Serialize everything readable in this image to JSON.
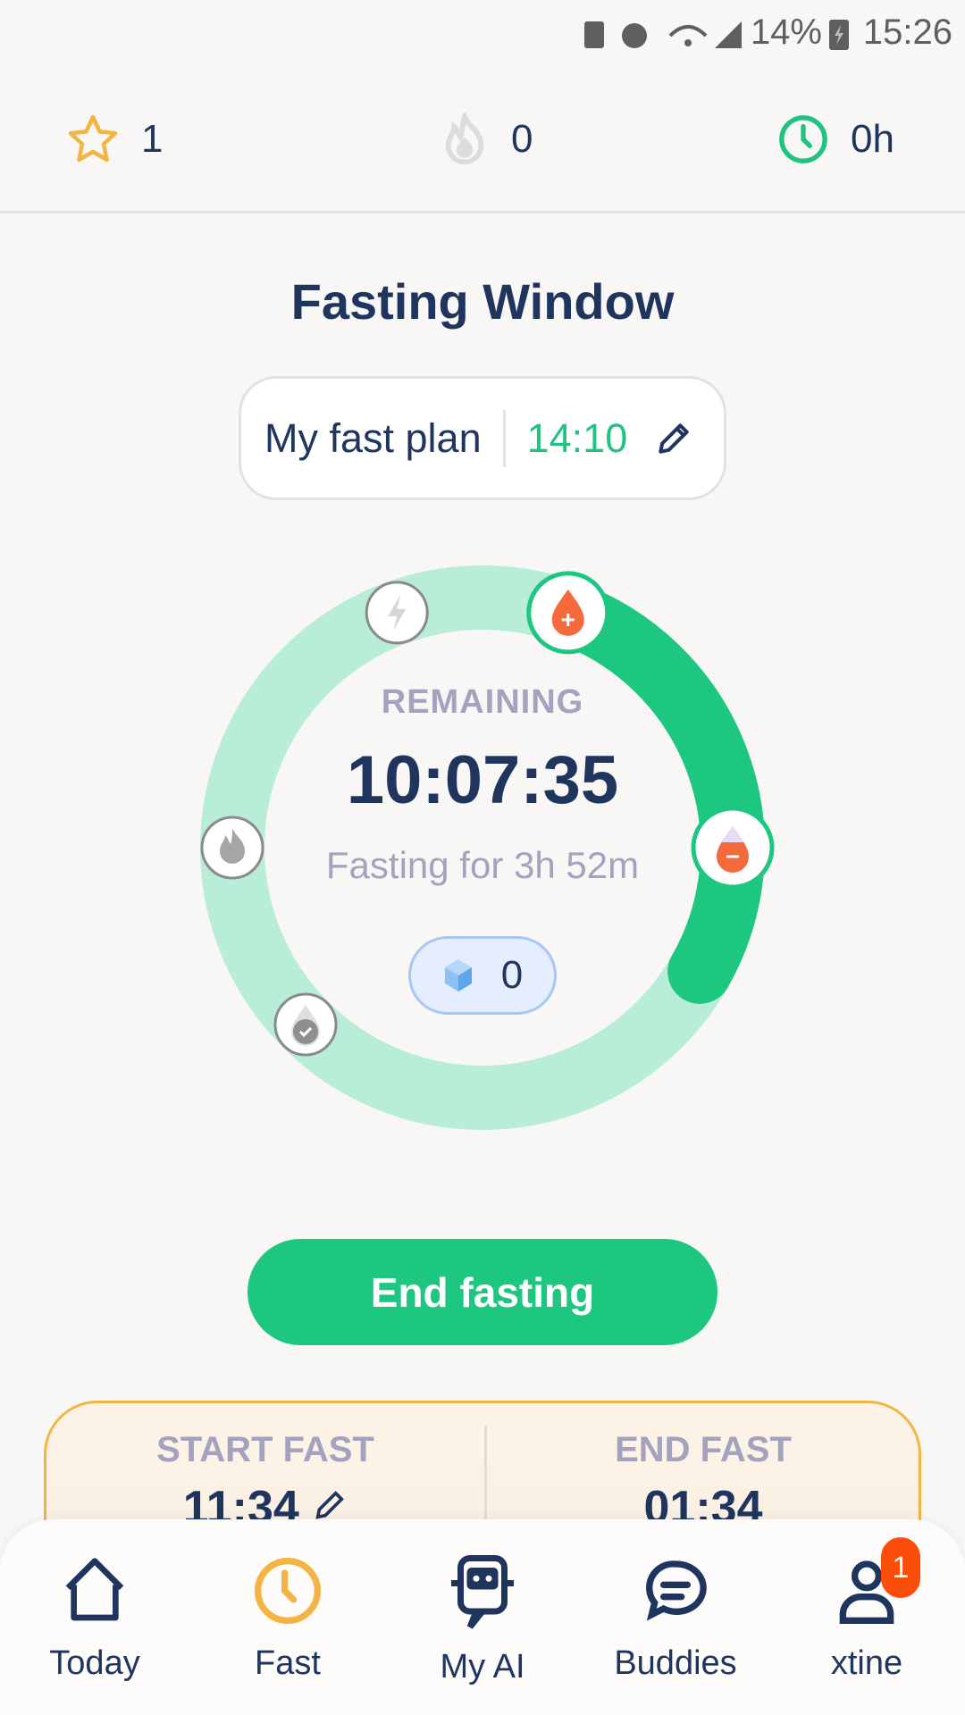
{
  "status_bar": {
    "battery_percent": "14%",
    "time": "15:26"
  },
  "stats": {
    "stars": "1",
    "streak": "0",
    "hours": "0h"
  },
  "title": "Fasting Window",
  "plan": {
    "label": "My fast plan",
    "value": "14:10"
  },
  "timer": {
    "label": "REMAINING",
    "remaining": "10:07:35",
    "fasting_for": "Fasting for 3h 52m",
    "gems": "0",
    "progress_fraction": 0.277,
    "plan_hours": 14
  },
  "end_button": "End fasting",
  "schedule": {
    "start_label": "START FAST",
    "start_time": "11:34",
    "end_label": "END FAST",
    "end_time": "01:34"
  },
  "nav": [
    {
      "label": "Today",
      "icon": "home-icon"
    },
    {
      "label": "Fast",
      "icon": "clock-icon",
      "active": true
    },
    {
      "label": "My AI",
      "icon": "robot-icon"
    },
    {
      "label": "Buddies",
      "icon": "chat-icon"
    },
    {
      "label": "xtine",
      "icon": "user-icon",
      "badge": "1"
    }
  ],
  "colors": {
    "primary": "#1dc77f",
    "track": "#b8eed8",
    "navy": "#1f355e",
    "accent": "#f4b443",
    "badge": "#fa4d0a"
  }
}
